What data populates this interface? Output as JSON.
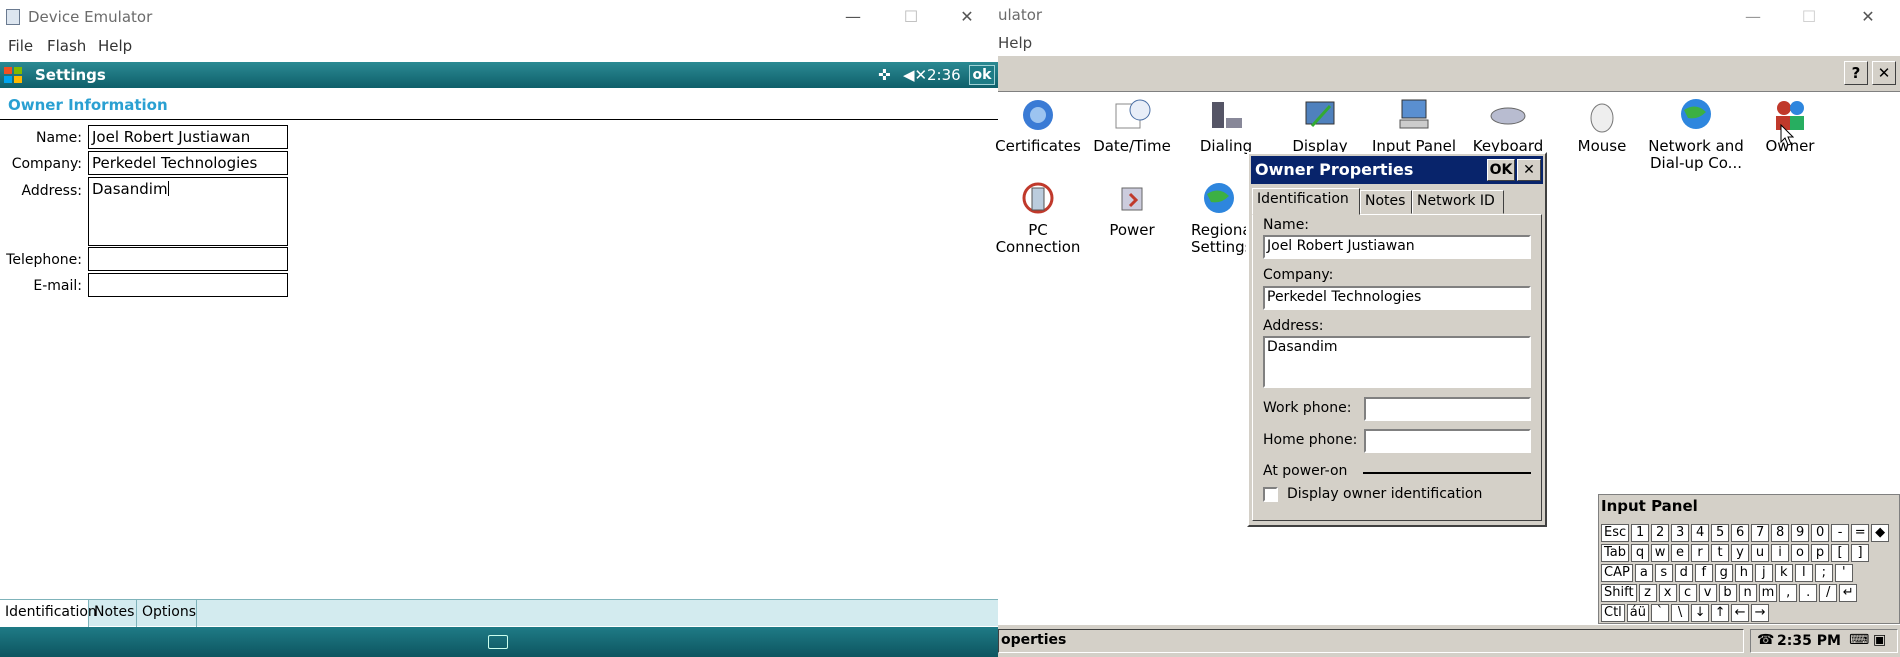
{
  "left": {
    "window_title": "Device Emulator",
    "menu": [
      "File",
      "Flash",
      "Help"
    ],
    "topbar": {
      "title": "Settings",
      "time": "2:36",
      "ok": "ok"
    },
    "heading": "Owner Information",
    "form": {
      "name_label": "Name:",
      "name_value": "Joel Robert Justiawan",
      "company_label": "Company:",
      "company_value": "Perkedel Technologies",
      "address_label": "Address:",
      "address_value": "Dasandim",
      "telephone_label": "Telephone:",
      "telephone_value": "",
      "email_label": "E-mail:",
      "email_value": ""
    },
    "tabs": [
      "Identification",
      "Notes",
      "Options"
    ]
  },
  "right": {
    "window_title_fragment": "ulator",
    "menu_fragment": "Help",
    "toolbar": {
      "help": "?",
      "close": "✕"
    },
    "control_panel": [
      {
        "label_lines": [
          "Certificates"
        ]
      },
      {
        "label_lines": [
          "Date/Time"
        ]
      },
      {
        "label_lines": [
          "Dialing"
        ]
      },
      {
        "label_lines": [
          "Display"
        ]
      },
      {
        "label_lines": [
          "Input Panel"
        ]
      },
      {
        "label_lines": [
          "Keyboard"
        ]
      },
      {
        "label_lines": [
          "Mouse"
        ]
      },
      {
        "label_lines": [
          "Network and",
          "Dial-up Co..."
        ]
      },
      {
        "label_lines": [
          "Owner"
        ]
      },
      {
        "label_lines": [
          "PC",
          "Connection"
        ]
      },
      {
        "label_lines": [
          "Power"
        ]
      },
      {
        "label_lines": [
          "Regional",
          "Settings"
        ]
      }
    ],
    "dialog": {
      "title": "Owner Properties",
      "ok": "OK",
      "close": "✕",
      "tabs": [
        "Identification",
        "Notes",
        "Network ID"
      ],
      "name_label": "Name:",
      "name_value": "Joel Robert Justiawan",
      "company_label": "Company:",
      "company_value": "Perkedel Technologies",
      "address_label": "Address:",
      "address_value": "Dasandim",
      "work_phone_label": "Work phone:",
      "work_phone_value": "",
      "home_phone_label": "Home phone:",
      "home_phone_value": "",
      "power_on_label": "At power-on",
      "checkbox_label": "Display owner identification",
      "checkbox_checked": false
    },
    "input_panel": {
      "title": "Input Panel",
      "rows": [
        [
          "Esc",
          "1",
          "2",
          "3",
          "4",
          "5",
          "6",
          "7",
          "8",
          "9",
          "0",
          "-",
          "=",
          "◆"
        ],
        [
          "Tab",
          "q",
          "w",
          "e",
          "r",
          "t",
          "y",
          "u",
          "i",
          "o",
          "p",
          "[",
          "]"
        ],
        [
          "CAP",
          "a",
          "s",
          "d",
          "f",
          "g",
          "h",
          "j",
          "k",
          "l",
          ";",
          "'"
        ],
        [
          "Shift",
          "z",
          "x",
          "c",
          "v",
          "b",
          "n",
          "m",
          ",",
          ".",
          "/",
          "↵"
        ],
        [
          "Ctl",
          "áü",
          "`",
          "\\",
          "↓",
          "↑",
          "←",
          "→"
        ]
      ]
    },
    "taskbar": {
      "task": "operties",
      "time": "2:35 PM"
    }
  }
}
